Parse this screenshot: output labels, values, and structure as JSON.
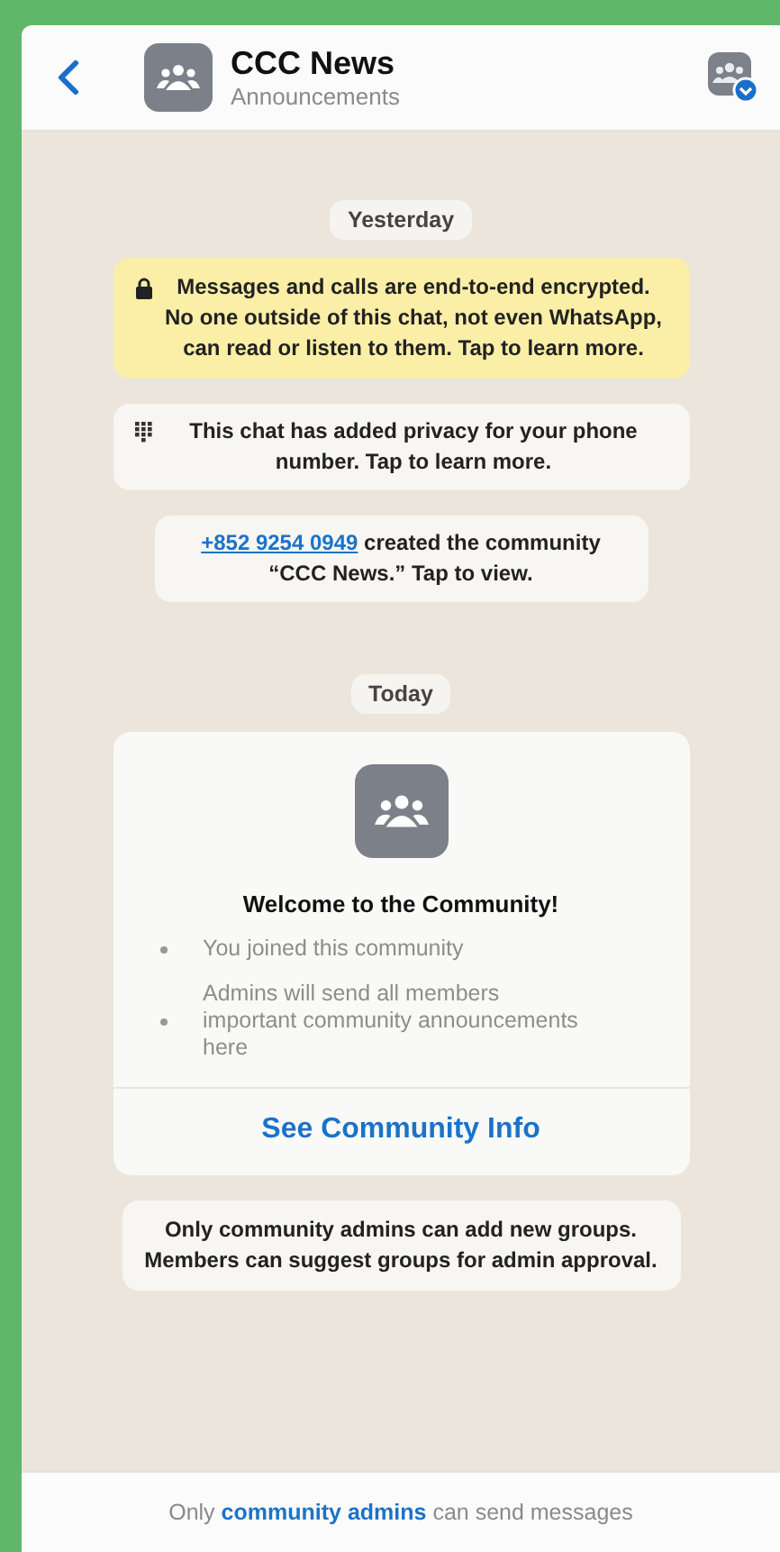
{
  "header": {
    "title": "CCC News",
    "subtitle": "Announcements"
  },
  "messages": [
    {
      "kind": "date",
      "text": "Yesterday"
    },
    {
      "kind": "encryption",
      "text": "Messages and calls are end-to-end encrypted. No one outside of this chat, not even WhatsApp, can read or listen to them. Tap to learn more."
    },
    {
      "kind": "privacy",
      "text": "This chat has added privacy for your phone number. Tap to learn more."
    },
    {
      "kind": "created",
      "link": "+852 9254 0949",
      "text": "created the community “CCC News.” Tap to view."
    },
    {
      "kind": "date",
      "text": "Today"
    },
    {
      "kind": "welcome",
      "title": "Welcome to the Community!",
      "bullets": [
        "You joined this community",
        "Admins will send all members important community announcements here"
      ],
      "action": "See Community Info"
    },
    {
      "kind": "notice",
      "text": "Only community admins can add new groups. Members can suggest groups for admin approval."
    }
  ],
  "footer": {
    "before": "Only",
    "link": "community admins",
    "after": "can send messages"
  }
}
